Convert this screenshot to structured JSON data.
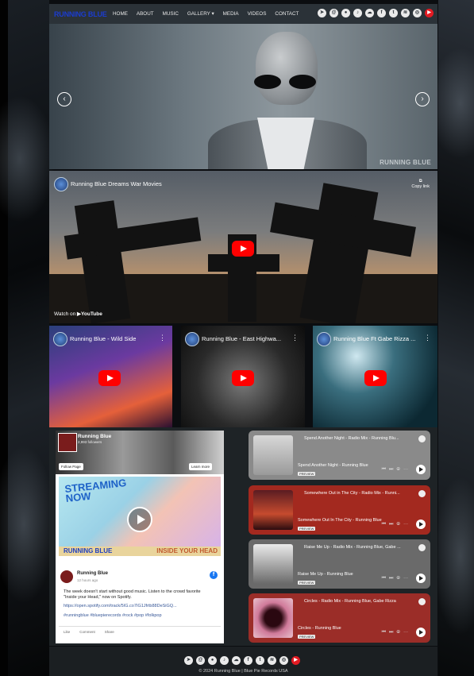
{
  "nav": {
    "logo": "RUNNING BLUE",
    "items": [
      {
        "label": "HOME"
      },
      {
        "label": "ABOUT"
      },
      {
        "label": "MUSIC"
      },
      {
        "label": "GALLERY ▾"
      },
      {
        "label": "MEDIA"
      },
      {
        "label": "VIDEOS"
      },
      {
        "label": "CONTACT"
      }
    ],
    "social_icons": [
      "telegram-icon",
      "email-icon",
      "chat-icon",
      "music-icon",
      "soundcloud-icon",
      "facebook-icon",
      "twitter-icon",
      "spotify-icon",
      "instagram-icon",
      "youtube-icon"
    ]
  },
  "hero": {
    "prev_label": "‹",
    "next_label": "›",
    "watermark": "RUNNING BLUE"
  },
  "main_video": {
    "title": "Running Blue Dreams War Movies",
    "copy_label": "Copy link",
    "watch_on": "Watch on",
    "watch_brand": "▶YouTube"
  },
  "small_videos": [
    {
      "title": "Running Blue - Wild Side"
    },
    {
      "title": "Running Blue - East Highwa..."
    },
    {
      "title": "Running Blue Ft Gabe Rizza ..."
    }
  ],
  "facebook": {
    "page_name": "Running Blue",
    "followers": "2,993 followers",
    "follow_btn": "Follow Page",
    "learn_btn": "Learn more",
    "post_banner_left": "STREAMING",
    "post_banner_left2": "NOW",
    "post_band_left": "RUNNING BLUE",
    "post_band_right": "INSIDE YOUR HEAD",
    "author": "Running Blue",
    "time": "12 hours ago",
    "text": "The week doesn't start without good music. Listen to the crowd favorite \"Inside your Head,\" now on Spotify.",
    "link": "https://open.spotify.com/track/5IG.co7IG1Jfrtb88DeSiGQ...",
    "tags": "#runningblue #bluepierecords #rock #pop #folkpop",
    "actions": [
      "Like",
      "Comment",
      "Share"
    ]
  },
  "spotify": [
    {
      "title": "Spend Another Night - Radio Mix - Running Blu...",
      "subtitle": "Spend Another Night - Running Blue",
      "preview": "PREVIEW",
      "color": "#8a8a8a"
    },
    {
      "title": "Somewhere Out in The City - Radio Mix - Runni...",
      "subtitle": "Somewhere Out In The City - Running Blue",
      "preview": "PREVIEW",
      "color": "#a3291f"
    },
    {
      "title": "Raise Me Up - Radio Mix - Running Blue, Gabe ...",
      "subtitle": "Raise Me Up - Running Blue",
      "preview": "PREVIEW",
      "color": "#6a6a6a"
    },
    {
      "title": "Circles - Radio Mix - Running Blue, Gabe Rizza",
      "subtitle": "Circles - Running Blue",
      "preview": "PREVIEW",
      "color": "#9b2d28"
    }
  ],
  "footer": {
    "copyright": "© 2024 Running Blue | Blue Pie Records USA"
  }
}
